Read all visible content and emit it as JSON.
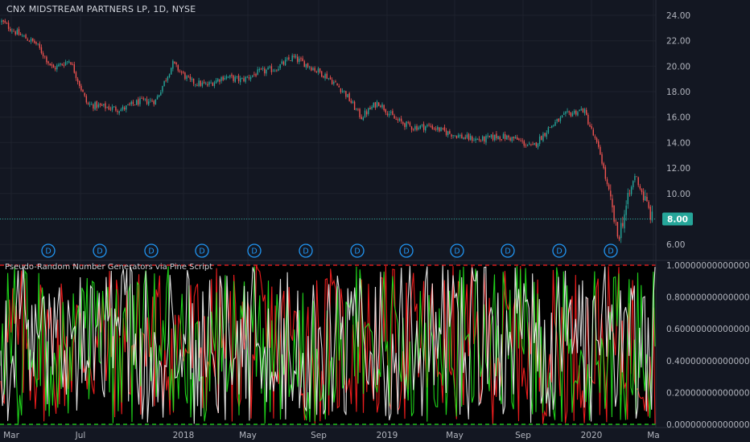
{
  "title": "CNX MIDSTREAM PARTNERS LP, 1D, NYSE",
  "indicator_title": "Pseudo-Random Number Generators via Pine Script",
  "price_label": "8.00",
  "colors": {
    "background": "#131722",
    "up": "#26a69a",
    "down": "#ef5350",
    "axis_text": "#b2b5be",
    "price_line": "#26a69a",
    "gen_a": "#ff1f1f",
    "gen_b": "#22e31c",
    "gen_c": "#f2f2f2",
    "dividend": "#2196f3"
  },
  "dividend_marker": "D",
  "chart_data": [
    {
      "type": "candlestick",
      "title": "CNX MIDSTREAM PARTNERS LP, 1D, NYSE",
      "x_ticks": [
        "Mar",
        "Jul",
        "2018",
        "May",
        "Sep",
        "2019",
        "May",
        "Sep",
        "2020",
        "Ma"
      ],
      "y_ticks": [
        "24.00",
        "22.00",
        "20.00",
        "18.00",
        "16.00",
        "14.00",
        "12.00",
        "10.00",
        "8.00",
        "6.00"
      ],
      "ylim": [
        5.0,
        25.2
      ],
      "last_price": 8.0,
      "approx_closes": [
        {
          "date": "Mar 2017",
          "close": 23.5
        },
        {
          "date": "Apr 2017",
          "close": 22.5
        },
        {
          "date": "May 2017",
          "close": 21.8
        },
        {
          "date": "Jun 2017",
          "close": 19.8
        },
        {
          "date": "Jul 2017",
          "close": 20.5
        },
        {
          "date": "Aug 2017",
          "close": 17.0
        },
        {
          "date": "Sep 2017",
          "close": 16.8
        },
        {
          "date": "Oct 2017",
          "close": 16.6
        },
        {
          "date": "Nov 2017",
          "close": 17.2
        },
        {
          "date": "Dec 2017",
          "close": 17.3
        },
        {
          "date": "Jan 2018",
          "close": 20.2
        },
        {
          "date": "Feb 2018",
          "close": 18.8
        },
        {
          "date": "Mar 2018",
          "close": 18.5
        },
        {
          "date": "Apr 2018",
          "close": 19.2
        },
        {
          "date": "May 2018",
          "close": 18.9
        },
        {
          "date": "Jun 2018",
          "close": 19.5
        },
        {
          "date": "Jul 2018",
          "close": 19.8
        },
        {
          "date": "Aug 2018",
          "close": 20.7
        },
        {
          "date": "Sep 2018",
          "close": 20.0
        },
        {
          "date": "Oct 2018",
          "close": 19.2
        },
        {
          "date": "Nov 2018",
          "close": 18.0
        },
        {
          "date": "Dec 2018",
          "close": 16.0
        },
        {
          "date": "Jan 2019",
          "close": 17.2
        },
        {
          "date": "Feb 2019",
          "close": 15.8
        },
        {
          "date": "Mar 2019",
          "close": 15.2
        },
        {
          "date": "Apr 2019",
          "close": 15.3
        },
        {
          "date": "May 2019",
          "close": 14.8
        },
        {
          "date": "Jun 2019",
          "close": 14.4
        },
        {
          "date": "Jul 2019",
          "close": 14.2
        },
        {
          "date": "Aug 2019",
          "close": 14.5
        },
        {
          "date": "Sep 2019",
          "close": 14.3
        },
        {
          "date": "Oct 2019",
          "close": 13.6
        },
        {
          "date": "Nov 2019",
          "close": 15.2
        },
        {
          "date": "Dec 2019",
          "close": 16.2
        },
        {
          "date": "Jan 2020",
          "close": 16.6
        },
        {
          "date": "Feb 2020",
          "close": 13.0
        },
        {
          "date": "Mar 2020",
          "close": 6.5
        },
        {
          "date": "Apr 2020",
          "close": 11.5
        },
        {
          "date": "Apr 2020 end",
          "close": 8.0
        }
      ],
      "dividend_markers": [
        "Apr 2017",
        "Jul 2017",
        "Oct 2017",
        "Jan 2018",
        "Apr 2018",
        "Jul 2018",
        "Oct 2018",
        "Jan 2019",
        "Apr 2019",
        "Jul 2019",
        "Oct 2019",
        "Jan 2020"
      ]
    },
    {
      "type": "line",
      "title": "Pseudo-Random Number Generators via Pine Script",
      "y_ticks": [
        "1.0000000000000000",
        "0.8000000000000000",
        "0.6000000000000001",
        "0.4000000000000001",
        "0.2000000000000001",
        "0.0000000000000001"
      ],
      "ylim": [
        0,
        1
      ],
      "reference_lines": [
        0,
        1
      ],
      "series_note": "three overlaid series of pseudo-random values uniformly distributed in [0, 1], one value per bar",
      "series_colors": [
        "red",
        "green",
        "white"
      ]
    }
  ]
}
